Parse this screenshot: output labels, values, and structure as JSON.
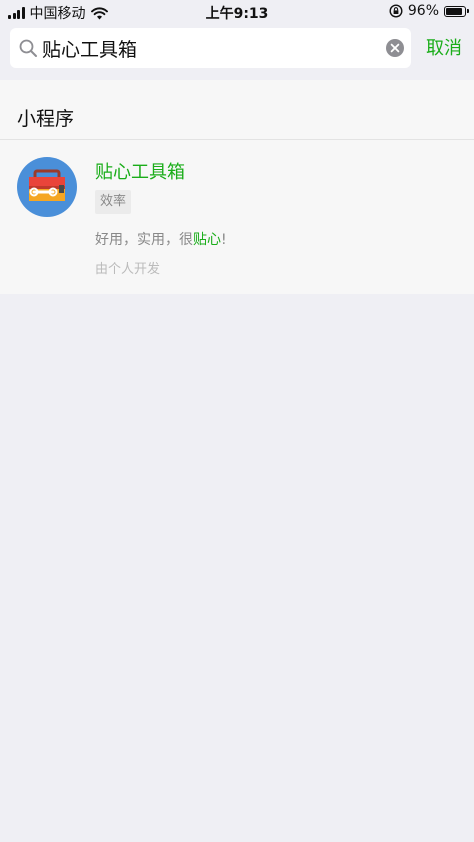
{
  "status_bar": {
    "carrier": "中国移动",
    "time": "上午9:13",
    "battery_text": "96%",
    "battery_level": 0.96
  },
  "search": {
    "query": "贴心工具箱",
    "cancel_label": "取消"
  },
  "results": {
    "section_title": "小程序",
    "items": [
      {
        "name": "贴心工具箱",
        "category": "效率",
        "desc_prefix": "好用，实用，很",
        "desc_highlight": "贴心",
        "desc_suffix": "!",
        "developer": "由个人开发",
        "icon": "toolbox-icon"
      }
    ]
  },
  "colors": {
    "accent": "#1aad19",
    "background": "#efeff4",
    "card": "#f7f7f7",
    "avatar_bg": "#4a8fd9"
  }
}
